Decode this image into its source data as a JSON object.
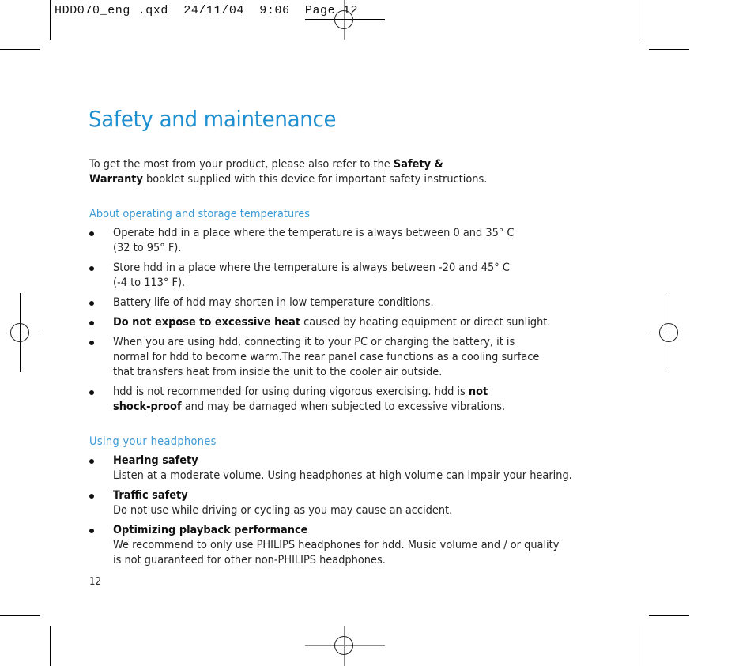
{
  "slug": {
    "text": "HDD070_eng .qxd  24/11/04  9:06  Page 12"
  },
  "title": "Safety and maintenance",
  "intro": {
    "text_before": "To get the most from your product, please also refer to the ",
    "bold_line1": "Safety &",
    "bold_line2": "Warranty",
    "text_after": " booklet supplied with this device for important safety instructions."
  },
  "sections": [
    {
      "heading": "About operating and storage temperatures",
      "items": [
        {
          "bold": "",
          "text_line1": "Operate hdd in a place where the temperature is always between 0 and 35° C",
          "text_line2": "(32 to 95° F)."
        },
        {
          "bold": "",
          "text_line1": "Store hdd in a place where the temperature is always between  -20 and 45° C",
          "text_line2": "(-4 to 113° F)."
        },
        {
          "bold": "",
          "text_line1": "Battery life of hdd may shorten in low temperature conditions.",
          "text_line2": ""
        },
        {
          "bold": "Do not expose to excessive heat",
          "text_line1": " caused by heating equipment or direct sunlight.",
          "text_line2": ""
        },
        {
          "bold": "",
          "text_line1": "When you are using hdd, connecting it to your PC or charging the battery, it is",
          "text_line2": "normal for hdd to become warm.The rear panel case functions as a cooling surface",
          "text_line3": "that transfers heat from inside the unit to the cooler air outside."
        },
        {
          "text_before": "hdd is not recommended for using during vigorous exercising. hdd is ",
          "bold_a": "not",
          "bold_b": "shock-proof",
          "text_after": " and may be damaged when subjected to excessive vibrations."
        }
      ]
    },
    {
      "heading": "Using your headphones",
      "items": [
        {
          "bold": "Hearing safety",
          "text": "Listen at a moderate volume. Using headphones at high volume can impair your hearing."
        },
        {
          "bold": "Traffic safety",
          "text": "Do not use while driving or cycling as you may cause an accident."
        },
        {
          "bold": "Optimizing playback performance",
          "text_line1": "We recommend to only use PHILIPS headphones for hdd.  Music volume and / or quality",
          "text_line2": "is not guaranteed for other non-PHILIPS headphones."
        }
      ]
    }
  ],
  "page_number": "12"
}
